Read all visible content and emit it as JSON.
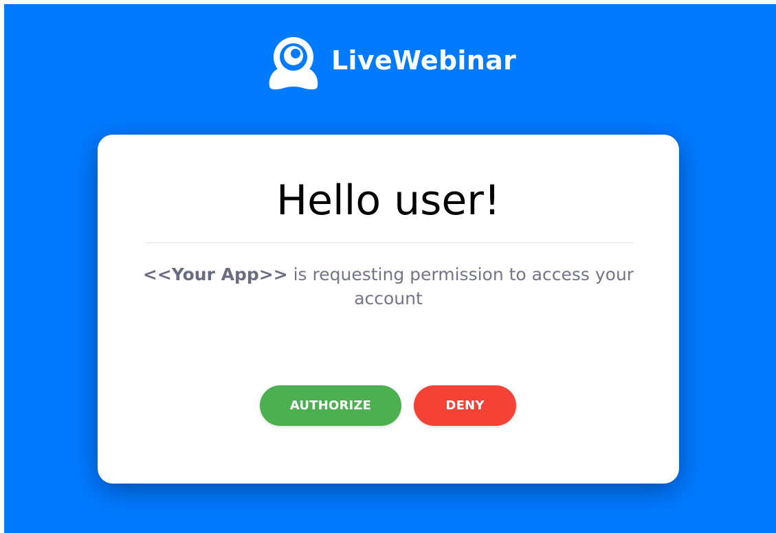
{
  "brand": {
    "name": "LiveWebinar",
    "logo_icon": "webcam-icon"
  },
  "card": {
    "greeting": "Hello user!",
    "message": {
      "app_name": "<<Your App>>",
      "text": " is requesting permission to access your account"
    }
  },
  "actions": {
    "authorize_label": "AUTHORIZE",
    "deny_label": "DENY"
  },
  "colors": {
    "background": "#007bff",
    "authorize": "#4caf50",
    "deny": "#f44336",
    "message_text": "#73738a"
  }
}
